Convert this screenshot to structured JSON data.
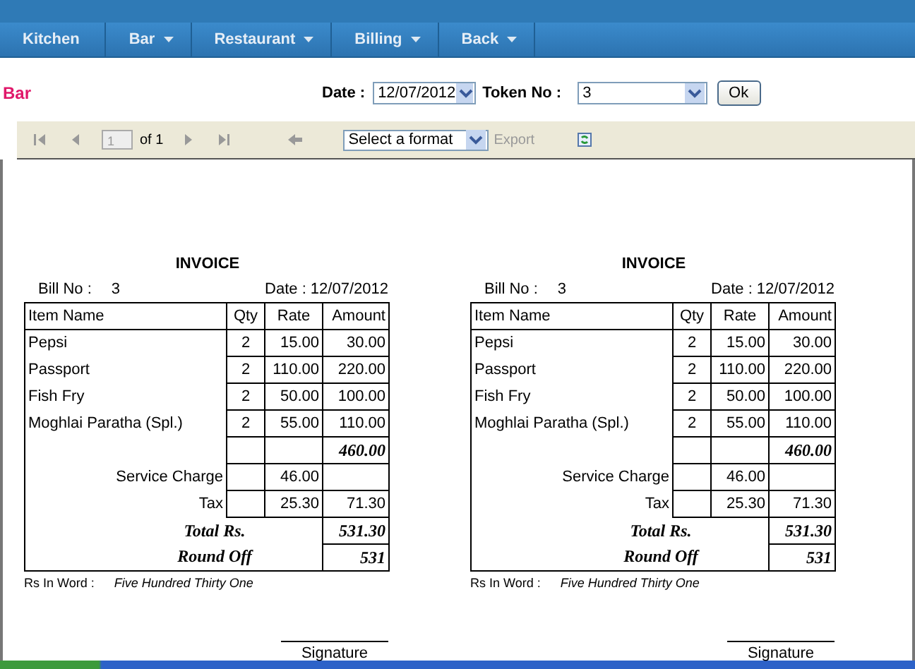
{
  "nav": [
    {
      "label": "Kitchen",
      "dropdown": false
    },
    {
      "label": "Bar",
      "dropdown": true
    },
    {
      "label": "Restaurant",
      "dropdown": true
    },
    {
      "label": "Billing",
      "dropdown": true
    },
    {
      "label": "Back",
      "dropdown": true
    }
  ],
  "page_title": "Bar",
  "filters": {
    "date_label": "Date :",
    "date_value": "12/07/2012",
    "token_label": "Token No :",
    "token_value": "3",
    "ok_button": "Ok"
  },
  "report_toolbar": {
    "page": "1",
    "page_of": "of 1",
    "format": "Select a format",
    "export": "Export",
    "export_disabled": true
  },
  "invoices": [
    {
      "title": "INVOICE",
      "bill_label": "Bill No :",
      "bill_no": "3",
      "date": "Date : 12/07/2012",
      "columns": [
        "Item Name",
        "Qty",
        "Rate",
        "Amount"
      ],
      "items": [
        {
          "name": "Pepsi",
          "qty": "2",
          "rate": "15.00",
          "amount": "30.00"
        },
        {
          "name": "Passport",
          "qty": "2",
          "rate": "110.00",
          "amount": "220.00"
        },
        {
          "name": "Fish Fry",
          "qty": "2",
          "rate": "50.00",
          "amount": "100.00"
        },
        {
          "name": "Moghlai Paratha (Spl.)",
          "qty": "2",
          "rate": "55.00",
          "amount": "110.00"
        }
      ],
      "subtotal": "460.00",
      "service_label": "Service Charge",
      "service_rate": "46.00",
      "tax_label": "Tax",
      "tax_rate": "25.30",
      "tax_amount": "71.30",
      "total_label": "Total Rs.",
      "total": "531.30",
      "round_label": "Round Off",
      "round": "531",
      "words_label": "Rs In Word :",
      "words": "Five Hundred Thirty One",
      "signature": "Signature"
    },
    {
      "title": "INVOICE",
      "bill_label": "Bill No :",
      "bill_no": "3",
      "date": "Date : 12/07/2012",
      "columns": [
        "Item Name",
        "Qty",
        "Rate",
        "Amount"
      ],
      "items": [
        {
          "name": "Pepsi",
          "qty": "2",
          "rate": "15.00",
          "amount": "30.00"
        },
        {
          "name": "Passport",
          "qty": "2",
          "rate": "110.00",
          "amount": "220.00"
        },
        {
          "name": "Fish Fry",
          "qty": "2",
          "rate": "50.00",
          "amount": "100.00"
        },
        {
          "name": "Moghlai Paratha (Spl.)",
          "qty": "2",
          "rate": "55.00",
          "amount": "110.00"
        }
      ],
      "subtotal": "460.00",
      "service_label": "Service Charge",
      "service_rate": "46.00",
      "tax_label": "Tax",
      "tax_rate": "25.30",
      "tax_amount": "71.30",
      "total_label": "Total Rs.",
      "total": "531.30",
      "round_label": "Round Off",
      "round": "531",
      "words_label": "Rs In Word :",
      "words": "Five Hundred Thirty One",
      "signature": "Signature"
    }
  ]
}
